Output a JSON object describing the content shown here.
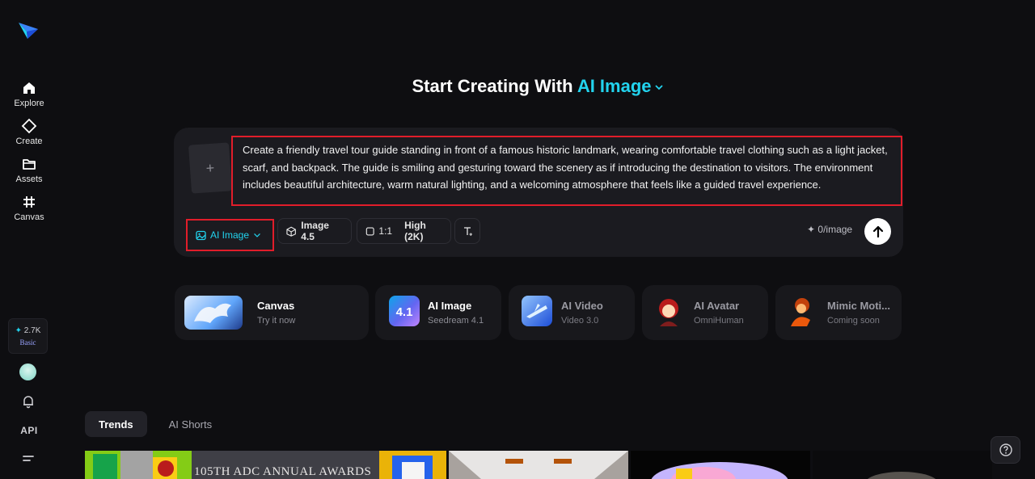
{
  "sidebar": {
    "items": [
      {
        "label": "Explore",
        "icon": "home-icon"
      },
      {
        "label": "Create",
        "icon": "diamond-icon"
      },
      {
        "label": "Assets",
        "icon": "folder-icon"
      },
      {
        "label": "Canvas",
        "icon": "canvas-grid-icon"
      }
    ],
    "credits": {
      "amount": "2.7K",
      "plan": "Basic"
    },
    "api_label": "API"
  },
  "headline": {
    "prefix": "Start Creating With",
    "mode": "AI Image"
  },
  "composer": {
    "upload_symbol": "+",
    "prompt": "Create a friendly travel tour guide standing in front of a famous historic landmark, wearing comfortable travel clothing such as a light jacket, scarf, and backpack. The guide is smiling and gesturing toward the scenery as if introducing the destination to visitors. The environment includes beautiful architecture, warm natural lighting, and a welcoming atmosphere that feels like a guided travel experience.",
    "mode_chip": "AI Image",
    "model_chip": "Image 4.5",
    "ratio": "1:1",
    "quality": "High (2K)",
    "cost": "0/image"
  },
  "tools": [
    {
      "title": "Canvas",
      "subtitle": "Try it now"
    },
    {
      "title": "AI Image",
      "subtitle": "Seedream 4.1"
    },
    {
      "title": "AI Video",
      "subtitle": "Video 3.0"
    },
    {
      "title": "AI Avatar",
      "subtitle": "OmniHuman"
    },
    {
      "title": "Mimic Moti...",
      "subtitle": "Coming soon"
    }
  ],
  "tabs": [
    "Trends",
    "AI Shorts"
  ],
  "gallery": {
    "banner_text": "105TH ADC ANNUAL AWARDS"
  },
  "colors": {
    "accent": "#22d3ee",
    "background": "#0e0e11",
    "highlight_border": "#e11d2a"
  }
}
